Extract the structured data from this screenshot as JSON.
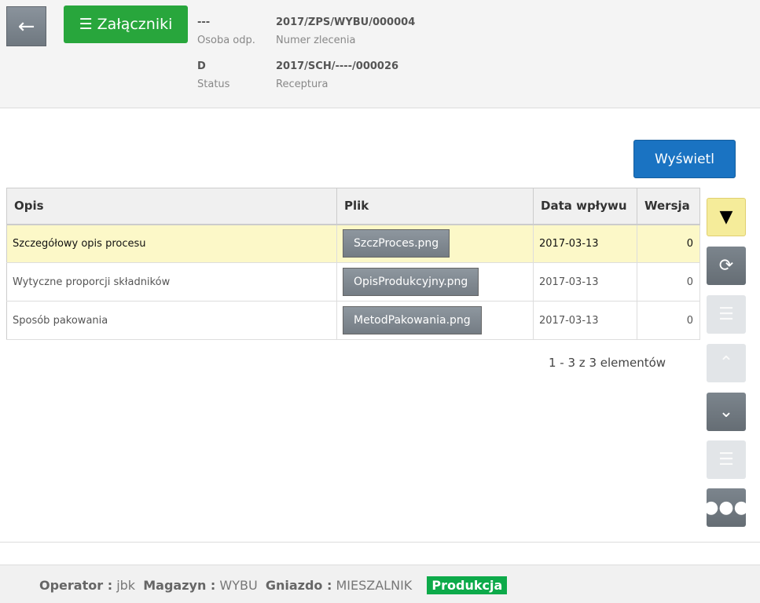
{
  "header": {
    "back_icon": "arrow-left-icon",
    "attachments_label": "Załączniki",
    "fields": [
      {
        "value": "---",
        "label": "Osoba odp."
      },
      {
        "value": "2017/ZPS/WYBU/000004",
        "label": "Numer zlecenia"
      },
      {
        "value": "D",
        "label": "Status"
      },
      {
        "value": "2017/SCH/----/000026",
        "label": "Receptura"
      }
    ]
  },
  "main": {
    "show_button": "Wyświetl",
    "columns": [
      "Opis",
      "Plik",
      "Data wpływu",
      "Wersja"
    ],
    "rows": [
      {
        "opis": "Szczegółowy opis procesu",
        "plik": "SzczProces.png",
        "data": "2017-03-13",
        "wersja": "0"
      },
      {
        "opis": "Wytyczne proporcji składników",
        "plik": "OpisProdukcyjny.png",
        "data": "2017-03-13",
        "wersja": "0"
      },
      {
        "opis": "Sposób pakowania",
        "plik": "MetodPakowania.png",
        "data": "2017-03-13",
        "wersja": "0"
      }
    ],
    "pager": "1 - 3 z 3 elementów"
  },
  "footer": {
    "operator_label": "Operator :",
    "operator": "jbk",
    "magazyn_label": "Magazyn :",
    "magazyn": "WYBU",
    "gniazdo_label": "Gniazdo :",
    "gniazdo": "MIESZALNIK",
    "mode": "Produkcja"
  }
}
